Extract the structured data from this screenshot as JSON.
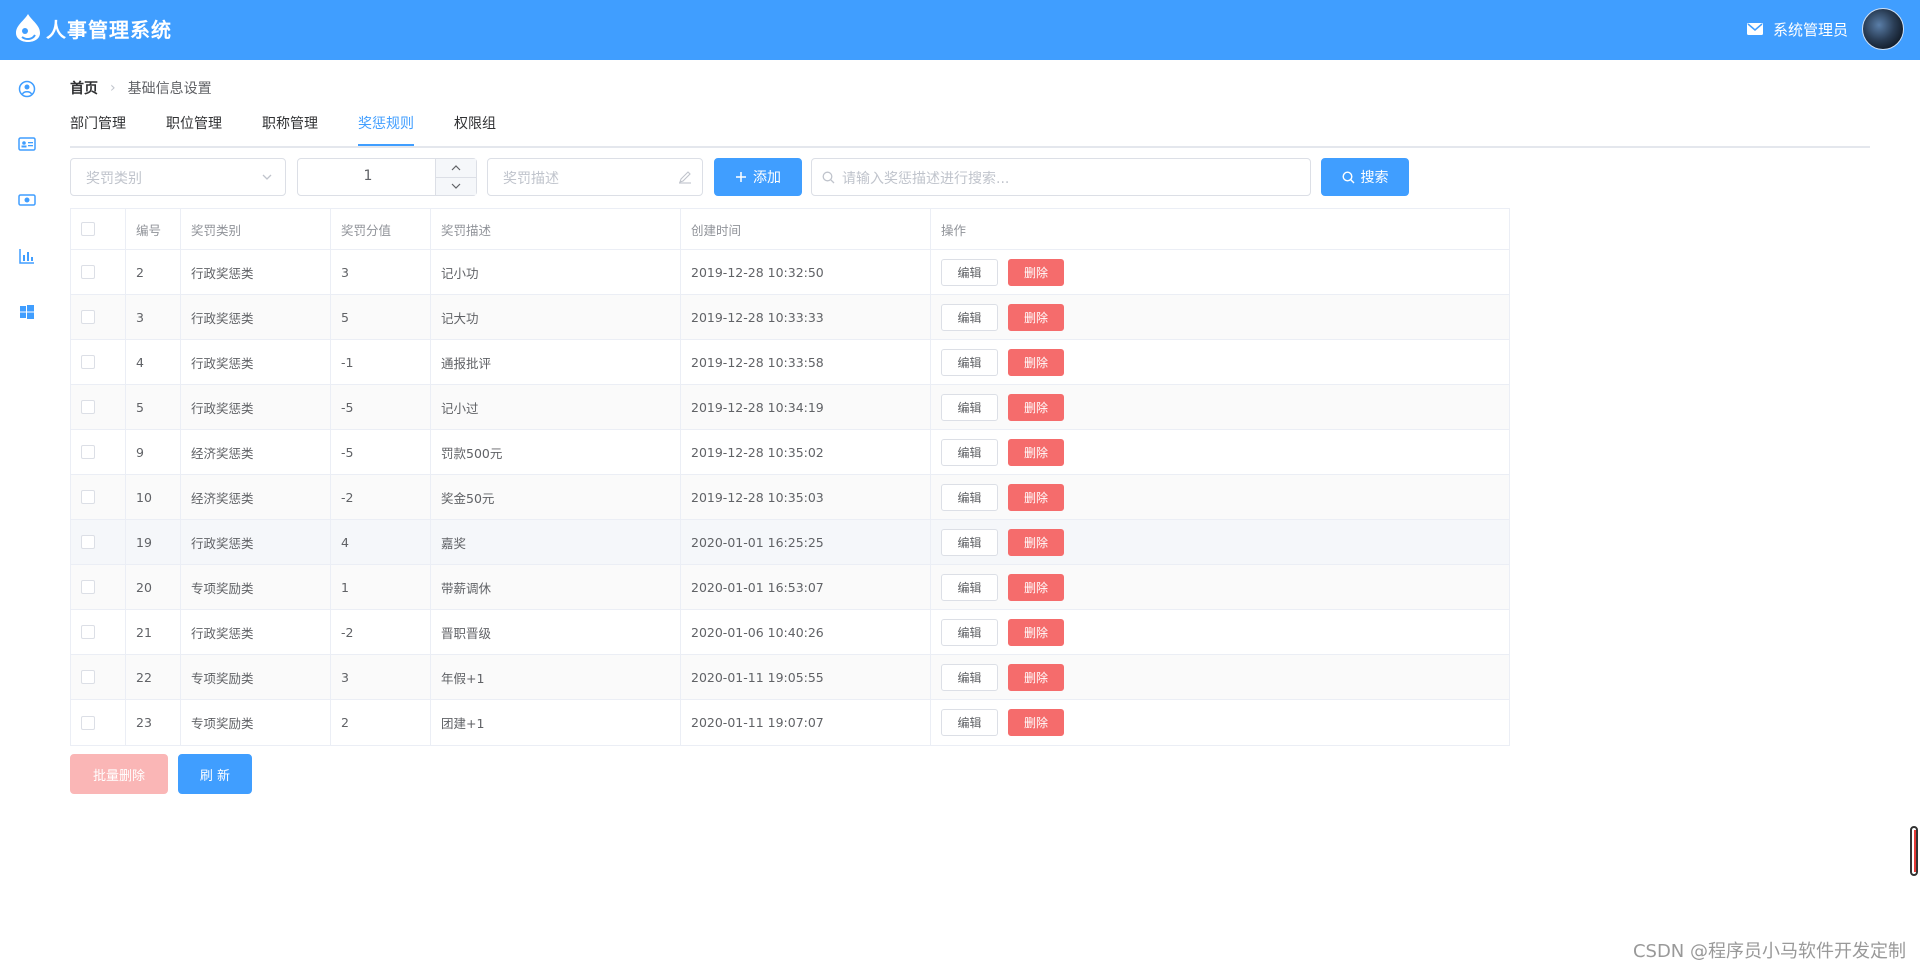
{
  "app": {
    "title": "人事管理系统"
  },
  "user": {
    "name": "系统管理员"
  },
  "breadcrumb": {
    "home": "首页",
    "current": "基础信息设置"
  },
  "tabs": [
    {
      "label": "部门管理",
      "active": false
    },
    {
      "label": "职位管理",
      "active": false
    },
    {
      "label": "职称管理",
      "active": false
    },
    {
      "label": "奖惩规则",
      "active": true
    },
    {
      "label": "权限组",
      "active": false
    }
  ],
  "toolbar": {
    "category_placeholder": "奖罚类别",
    "score_value": "1",
    "desc_placeholder": "奖罚描述",
    "add_label": "添加",
    "search_placeholder": "请输入奖惩描述进行搜索...",
    "search_label": "搜索"
  },
  "table": {
    "headers": [
      "编号",
      "奖罚类别",
      "奖罚分值",
      "奖罚描述",
      "创建时间",
      "操作"
    ],
    "edit_label": "编辑",
    "delete_label": "删除",
    "rows": [
      {
        "id": "2",
        "category": "行政奖惩类",
        "score": "3",
        "desc": "记小功",
        "created": "2019-12-28 10:32:50"
      },
      {
        "id": "3",
        "category": "行政奖惩类",
        "score": "5",
        "desc": "记大功",
        "created": "2019-12-28 10:33:33"
      },
      {
        "id": "4",
        "category": "行政奖惩类",
        "score": "-1",
        "desc": "通报批评",
        "created": "2019-12-28 10:33:58"
      },
      {
        "id": "5",
        "category": "行政奖惩类",
        "score": "-5",
        "desc": "记小过",
        "created": "2019-12-28 10:34:19"
      },
      {
        "id": "9",
        "category": "经济奖惩类",
        "score": "-5",
        "desc": "罚款500元",
        "created": "2019-12-28 10:35:02"
      },
      {
        "id": "10",
        "category": "经济奖惩类",
        "score": "-2",
        "desc": "奖金50元",
        "created": "2019-12-28 10:35:03"
      },
      {
        "id": "19",
        "category": "行政奖惩类",
        "score": "4",
        "desc": "嘉奖",
        "created": "2020-01-01 16:25:25"
      },
      {
        "id": "20",
        "category": "专项奖励类",
        "score": "1",
        "desc": "带薪调休",
        "created": "2020-01-01 16:53:07"
      },
      {
        "id": "21",
        "category": "行政奖惩类",
        "score": "-2",
        "desc": "晋职晋级",
        "created": "2020-01-06 10:40:26"
      },
      {
        "id": "22",
        "category": "专项奖励类",
        "score": "3",
        "desc": "年假+1",
        "created": "2020-01-11 19:05:55"
      },
      {
        "id": "23",
        "category": "专项奖励类",
        "score": "2",
        "desc": "团建+1",
        "created": "2020-01-11 19:07:07"
      }
    ]
  },
  "actions": {
    "batch_delete_label": "批量删除",
    "refresh_label": "刷 新"
  },
  "watermark": "CSDN @程序员小马软件开发定制",
  "colors": {
    "primary": "#409eff",
    "danger": "#f56c6c",
    "danger_light": "#fab6b6",
    "border": "#ebeef5"
  },
  "icons": [
    "logo-drop-icon",
    "mail-icon",
    "user-icon",
    "id-card-icon",
    "money-icon",
    "bar-chart-icon",
    "windows-icon",
    "chevron-down-icon",
    "plus-icon",
    "search-icon",
    "edit-pen-icon",
    "chevron-up-icon"
  ]
}
